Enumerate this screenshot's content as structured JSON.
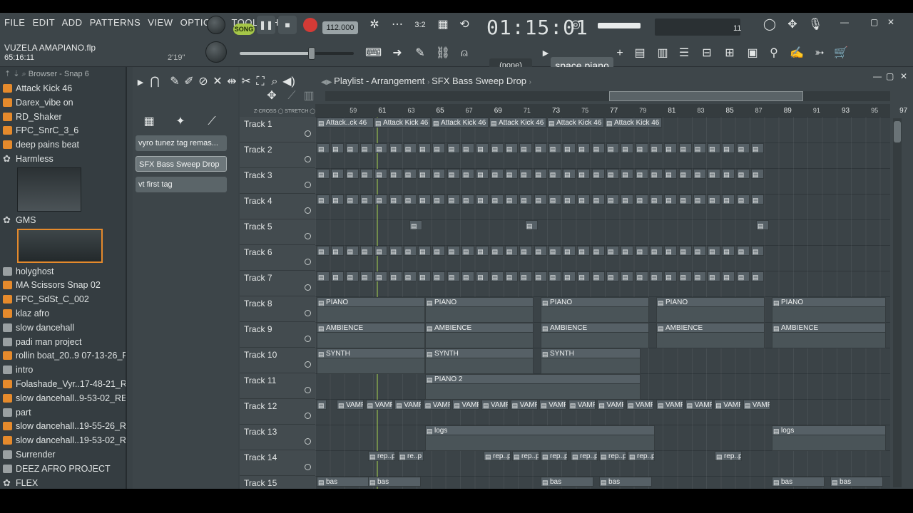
{
  "menu": [
    "FILE",
    "EDIT",
    "ADD",
    "PATTERNS",
    "VIEW",
    "OPTIONS",
    "TOOLS",
    "HELP"
  ],
  "project": {
    "title": "VUZELA AMAPIANO.flp",
    "time": "65:16:11",
    "length": "2'19\""
  },
  "transport": {
    "mode": "SONG",
    "tempo": "112.000",
    "time": "01:15:01",
    "cpu": "11"
  },
  "toolbar": {
    "snap": "(none)",
    "pattern": "space piano",
    "recording_label": "SFX"
  },
  "browser": {
    "header": "Browser - Snap 6",
    "items": [
      {
        "label": "Attack Kick 46",
        "icon": "folder-orange"
      },
      {
        "label": "Darex_vibe on",
        "icon": "folder-orange"
      },
      {
        "label": "RD_Shaker",
        "icon": "folder-orange"
      },
      {
        "label": "FPC_SnrC_3_6",
        "icon": "folder-orange"
      },
      {
        "label": "deep pains beat",
        "icon": "folder-orange"
      },
      {
        "label": "Harmless",
        "icon": "gear"
      },
      {
        "label": "GMS",
        "icon": "gear"
      },
      {
        "label": "holyghost",
        "icon": "folder-gray"
      },
      {
        "label": "MA Scissors Snap 02",
        "icon": "folder-orange"
      },
      {
        "label": "FPC_SdSt_C_002",
        "icon": "folder-orange"
      },
      {
        "label": "klaz afro",
        "icon": "folder-orange"
      },
      {
        "label": "slow dancehall",
        "icon": "folder-gray"
      },
      {
        "label": "padi man project",
        "icon": "folder-gray"
      },
      {
        "label": "rollin boat_20..9 07-13-26_REC",
        "icon": "folder-orange"
      },
      {
        "label": "intro",
        "icon": "folder-gray"
      },
      {
        "label": "Folashade_Vyr..17-48-21_REC",
        "icon": "folder-orange"
      },
      {
        "label": "slow dancehall..9-53-02_REC_2",
        "icon": "folder-orange"
      },
      {
        "label": "part",
        "icon": "folder-gray"
      },
      {
        "label": "slow dancehall..19-55-26_REC",
        "icon": "folder-orange"
      },
      {
        "label": "slow dancehall..19-53-02_REC",
        "icon": "folder-orange"
      },
      {
        "label": "Surrender",
        "icon": "folder-gray"
      },
      {
        "label": "DEEZ AFRO PROJECT",
        "icon": "folder-gray"
      },
      {
        "label": "FLEX",
        "icon": "gear"
      }
    ]
  },
  "picker": {
    "items": [
      {
        "label": "vyro tunez tag remas..."
      },
      {
        "label": "SFX Bass Sweep Drop"
      },
      {
        "label": "vt first tag"
      }
    ]
  },
  "playlist": {
    "title": "Playlist - Arrangement",
    "current": "SFX Bass Sweep Drop",
    "zcross": "Z-CROSS",
    "stretch": "STRETCH",
    "ruler": [
      "59",
      "61",
      "63",
      "65",
      "67",
      "69",
      "71",
      "73",
      "75",
      "77",
      "79",
      "81",
      "83",
      "85",
      "87",
      "89",
      "91",
      "93",
      "95",
      "97"
    ],
    "tracks": [
      "Track 1",
      "Track 2",
      "Track 3",
      "Track 4",
      "Track 5",
      "Track 6",
      "Track 7",
      "Track 8",
      "Track 9",
      "Track 10",
      "Track 11",
      "Track 12",
      "Track 13",
      "Track 14",
      "Track 15"
    ],
    "clips": {
      "kick": "Attack..ck 46",
      "kick_full": "Attack Kick 46",
      "piano": "PIANO",
      "ambience": "AMBIENCE",
      "synth": "SYNTH",
      "piano2": "PIANO 2",
      "vamp": "VAMP",
      "logs": "logs",
      "rep": "rep..p",
      "re": "re..p",
      "bas": "bas"
    }
  }
}
